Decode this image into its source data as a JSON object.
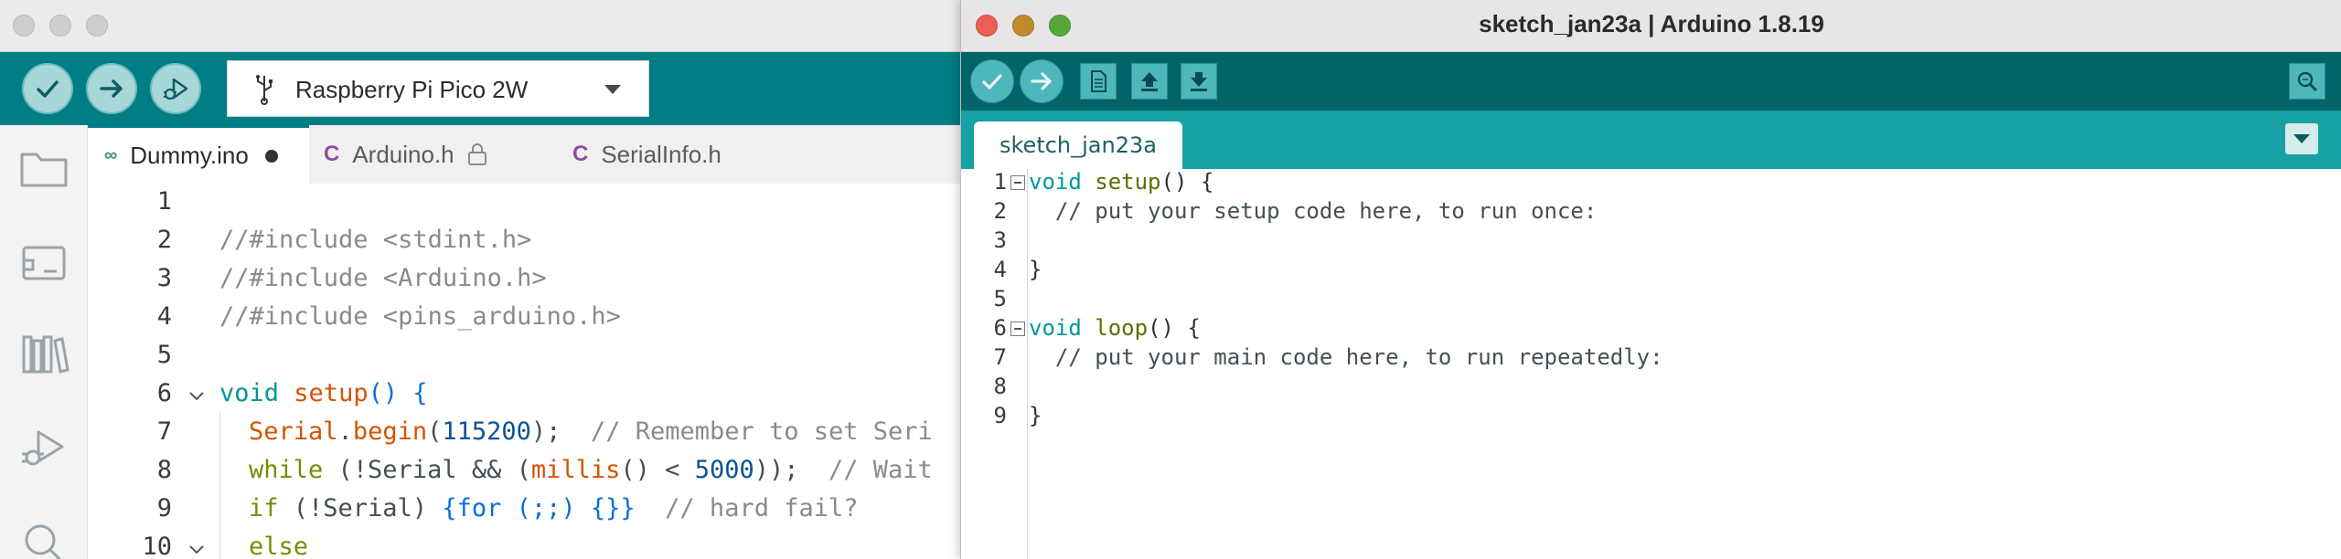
{
  "ide2": {
    "board": "Raspberry Pi Pico 2W",
    "tabs": [
      {
        "label": "Dummy.ino",
        "modified": true
      },
      {
        "label": "Arduino.h",
        "locked": true
      },
      {
        "label": "SerialInfo.h"
      }
    ],
    "line_numbers": [
      "1",
      "2",
      "3",
      "4",
      "5",
      "6",
      "7",
      "8",
      "9",
      "10"
    ],
    "code": {
      "l2": "//#include <stdint.h>",
      "l3": "//#include <Arduino.h>",
      "l4": "//#include <pins_arduino.h>",
      "l6_kw": "void",
      "l6_fn": "setup",
      "l6_rest": "() {",
      "l7_obj": "Serial",
      "l7_dot": ".",
      "l7_fn": "begin",
      "l7_open": "(",
      "l7_num": "115200",
      "l7_close": ");",
      "l7_cmt": "  // Remember to set Seri",
      "l8_kw": "while",
      "l8_a": " (!Serial && (",
      "l8_fn": "millis",
      "l8_b": "() < ",
      "l8_num": "5000",
      "l8_c": "));",
      "l8_cmt": "  // Wait",
      "l9_kw": "if",
      "l9_a": " (!Serial) ",
      "l9_br": "{for (;;) {}}",
      "l9_cmt": "  // hard fail?",
      "l10_kw": "else"
    },
    "colors": {
      "toolbar": "#017e84",
      "accent": "#00979c"
    }
  },
  "ide1": {
    "title": "sketch_jan23a | Arduino 1.8.19",
    "tab": "sketch_jan23a",
    "line_numbers": [
      "1",
      "2",
      "3",
      "4",
      "5",
      "6",
      "7",
      "8",
      "9"
    ],
    "code": {
      "l1_kw": "void",
      "l1_fn": "setup",
      "l1_rest": "() {",
      "l2": "  // put your setup code here, to run once:",
      "l4": "}",
      "l6_kw": "void",
      "l6_fn": "loop",
      "l6_rest": "() {",
      "l7": "  // put your main code here, to run repeatedly:",
      "l9": "}"
    },
    "colors": {
      "toolbar": "#006468",
      "tabbar": "#17a1a5"
    }
  }
}
